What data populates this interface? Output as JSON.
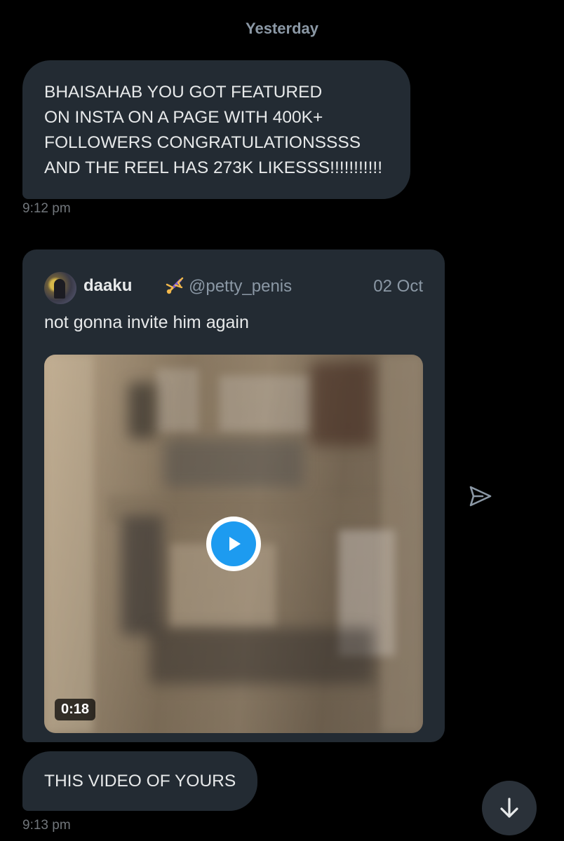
{
  "date_separator": "Yesterday",
  "messages": [
    {
      "lines": [
        "BHAISAHAB YOU GOT FEATURED",
        "ON INSTA ON A PAGE WITH 400K+",
        "FOLLOWERS CONGRATULATIONSSSS",
        "AND THE REEL HAS 273K LIKESSS!!!!!!!!!!!"
      ],
      "time": "9:12 pm"
    },
    {
      "text": "THIS VIDEO OF YOURS",
      "time": "9:13 pm"
    }
  ],
  "shared_tweet": {
    "display_name": "daaku",
    "name_emoji": "person-cartwheeling-icon",
    "handle": "@petty_penis",
    "date": "02 Oct",
    "text": "not gonna invite him again",
    "video": {
      "duration": "0:18",
      "play_icon": "play-icon"
    }
  },
  "icons": {
    "share": "send-icon",
    "scroll": "arrow-down-icon"
  },
  "colors": {
    "background": "#000000",
    "bubble": "#232b33",
    "text": "#e7e9ea",
    "muted": "#71767b",
    "accent": "#1d9bf0"
  }
}
